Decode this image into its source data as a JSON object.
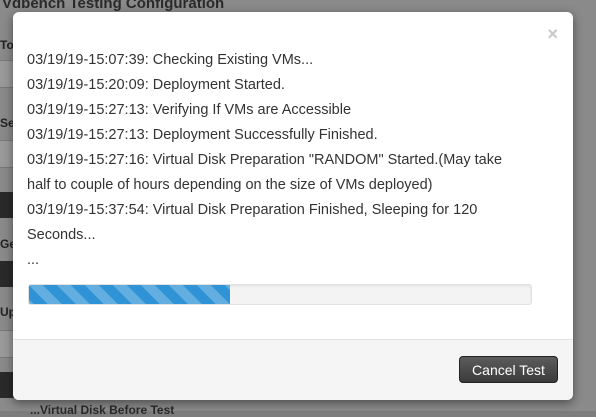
{
  "background": {
    "title": "Vdbench Testing Configuration",
    "footer_fragment": "...Virtual Disk Before Test"
  },
  "modal": {
    "close_glyph": "×",
    "log_lines": [
      "03/19/19-15:07:39: Checking Existing VMs...",
      "03/19/19-15:20:09: Deployment Started.",
      "03/19/19-15:27:13: Verifying If VMs are Accessible",
      "03/19/19-15:27:13: Deployment Successfully Finished.",
      "03/19/19-15:27:16: Virtual Disk Preparation \"RANDOM\" Started.(May take",
      "half to couple of hours depending on the size of VMs deployed)",
      "03/19/19-15:37:54: Virtual Disk Preparation Finished, Sleeping for 120",
      "Seconds...",
      "..."
    ],
    "progress_fraction": 0.4,
    "progress_color": "#2f93d6",
    "cancel_label": "Cancel Test"
  }
}
